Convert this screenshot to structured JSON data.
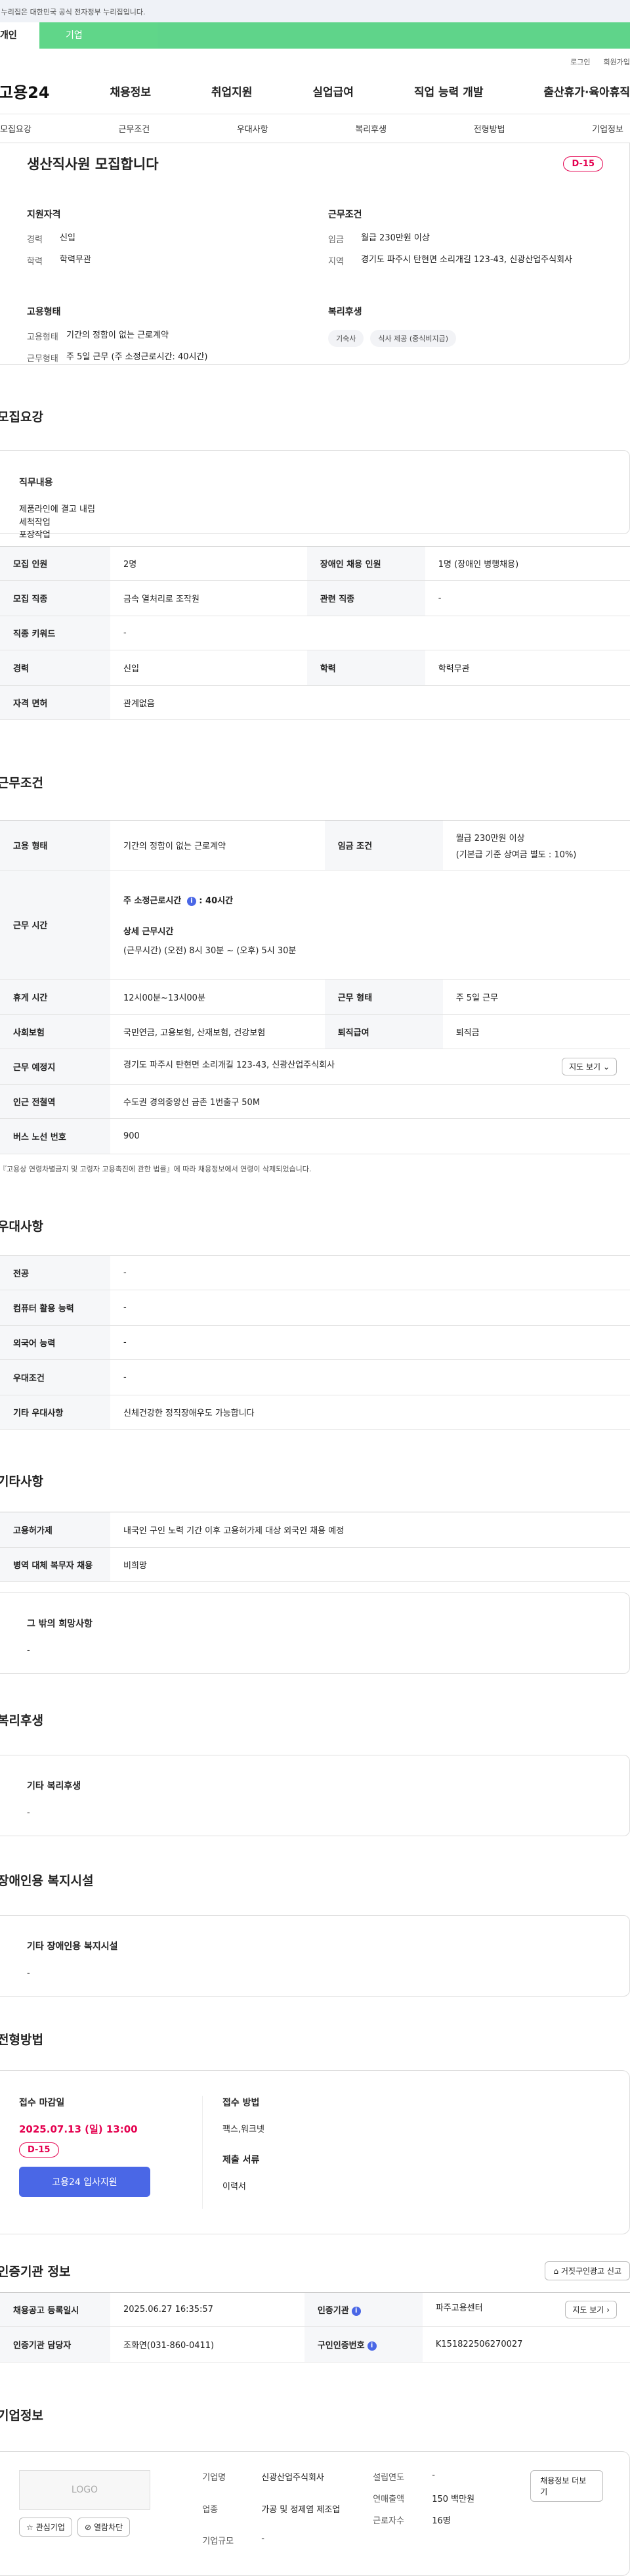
{
  "gov_bar": "이 누리집은 대한민국 공식 전자정부 누리집입니다.",
  "user_tabs": [
    "개인",
    "기업"
  ],
  "util": [
    "로그인",
    "회원가입"
  ],
  "gnb": {
    "logo": "고용24",
    "menu": [
      "채용정보",
      "취업지원",
      "실업급여",
      "직업 능력 개발",
      "출산휴가·육아휴직"
    ]
  },
  "sub_tabs": [
    "모집요강",
    "근무조건",
    "우대사항",
    "복리후생",
    "전형방법",
    "기업정보"
  ],
  "head": {
    "title": "생산직사원 모집합니다",
    "dday": "D-15",
    "qual_title": "지원자격",
    "career_k": "경력",
    "career_v": "신입",
    "edu_k": "학력",
    "edu_v": "학력무관",
    "cond_title": "근무조건",
    "wage_k": "임금",
    "wage_v": "월급 230만원 이상",
    "region_k": "지역",
    "region_v": "경기도 파주시 탄현면 소리개길 123-43, 신광산업주식회사",
    "emp_title": "고용형태",
    "etype_k": "고용형태",
    "etype_v": "기간의 정함이 없는 근로계약",
    "wform_k": "근무형태",
    "wform_v": "주 5일 근무 (주 소정근로시간: 40시간)",
    "welfare_title": "복리후생",
    "chips": [
      "기숙사",
      "식사 제공 (중식비지급)"
    ]
  },
  "recruit": {
    "title": "모집요강",
    "duty_h": "직무내용",
    "duty_lines": [
      "제품라인에 결고 내림",
      "세척작업",
      "포장작업"
    ],
    "rows": {
      "n_k": "모집 인원",
      "n_v": "2명",
      "dis_k": "장애인 채용 인원",
      "dis_v": "1명 (장애인 병행채용)",
      "job_k": "모집 직종",
      "job_v": "금속 열처리로 조작원",
      "rel_k": "관련 직종",
      "rel_v": "-",
      "kw_k": "직종 키워드",
      "kw_v": "-",
      "car_k": "경력",
      "car_v": "신입",
      "edu_k": "학력",
      "edu_v": "학력무관",
      "lic_k": "자격 면허",
      "lic_v": "관계없음"
    }
  },
  "work": {
    "title": "근무조건",
    "etype_k": "고용 형태",
    "etype_v": "기간의 정함이 없는 근로계약",
    "wage_k": "임금 조건",
    "wage_v1": "월급 230만원 이상",
    "wage_v2": "(기본급 기준 상여금 별도 : 10%)",
    "time_k": "근무 시간",
    "time_h1": "주 소정근로시간",
    "time_v1": "40시간",
    "time_h2": "상세 근무시간",
    "time_v2": "(근무시간) (오전) 8시 30분 ~ (오후) 5시 30분",
    "rest_k": "휴게 시간",
    "rest_v": "12시00분~13시00분",
    "wf_k": "근무 형태",
    "wf_v": "주 5일 근무",
    "ins_k": "사회보험",
    "ins_v": "국민연금, 고용보험, 산재보험, 건강보험",
    "ret_k": "퇴직급여",
    "ret_v": "퇴직금",
    "loc_k": "근무 예정지",
    "loc_v": "경기도 파주시 탄현면 소리개길 123-43, 신광산업주식회사",
    "map_btn": "지도 보기",
    "sub_k": "인근 전철역",
    "sub_v": "수도권 경의중앙선 금촌 1번출구 50M",
    "bus_k": "버스 노선 번호",
    "bus_v": "900",
    "note": "* 『고용상 연령차별금지 및 고령자 고용촉진에 관한 법률』에 따라 채용정보에서 연령이 삭제되었습니다."
  },
  "pref": {
    "title": "우대사항",
    "r1_k": "전공",
    "r1_v": "-",
    "r2_k": "컴퓨터 활용 능력",
    "r2_v": "-",
    "r3_k": "외국어 능력",
    "r3_v": "-",
    "r4_k": "우대조건",
    "r4_v": "-",
    "r5_k": "기타 우대사항",
    "r5_v": "신체건강한 정직장애우도 가능합니다"
  },
  "etc": {
    "title": "기타사항",
    "r1_k": "고용허가제",
    "r1_v": "내국인 구인 노력 기간 이후 고용허가제 대상 외국인 채용 예정",
    "r2_k": "병역 대체 복무자 채용",
    "r2_v": "비희망",
    "wish_h": "그 밖의 희망사항",
    "wish_v": "-"
  },
  "welfare": {
    "title": "복리후생",
    "h": "기타 복리후생",
    "v": "-"
  },
  "dis_fac": {
    "title": "장애인용 복지시설",
    "h": "기타 장애인용 복지시설",
    "v": "-"
  },
  "apply": {
    "title": "전형방법",
    "deadline_h": "접수 마감일",
    "deadline_v": "2025.07.13 (일) 13:00",
    "dday": "D-15",
    "btn": "고용24 입사지원",
    "method_h": "접수 방법",
    "method_v": "팩스,워크넷",
    "docs_h": "제출 서류",
    "docs_v": "이력서"
  },
  "cert": {
    "title": "인증기관 정보",
    "report_btn": "거짓구인광고 신고",
    "r1_k": "채용공고 등록일시",
    "r1_v": "2025.06.27 16:35:57",
    "r1b_k": "인증기관",
    "r1b_v": "파주고용센터",
    "map_btn": "지도 보기",
    "r2_k": "인증기관 담당자",
    "r2_v": "조화연(031-860-0411)",
    "r2b_k": "구인인증번호",
    "r2b_v": "K151822506270027"
  },
  "company": {
    "title": "기업정보",
    "logo": "LOGO",
    "fav": "관심기업",
    "block": "열람차단",
    "name_k": "기업명",
    "name_v": "신광산업주식회사",
    "ind_k": "업종",
    "ind_v": "가공 및 정제염 제조업",
    "size_k": "기업규모",
    "size_v": "-",
    "year_k": "설립연도",
    "year_v": "-",
    "sales_k": "연매출액",
    "sales_v": "150 백만원",
    "emp_k": "근로자수",
    "emp_v": "16명",
    "jobs_btn": "채용정보 더보기"
  }
}
